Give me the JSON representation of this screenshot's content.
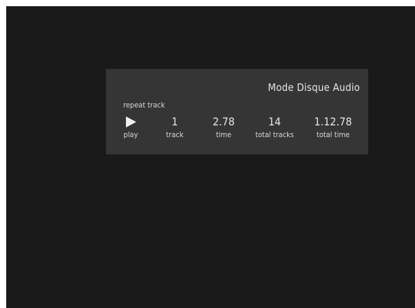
{
  "window": {
    "background": "#1a1a1a",
    "panel_background": "#353535"
  },
  "panel": {
    "mode_title": "Mode Disque Audio",
    "repeat_label": "repeat track",
    "play": {
      "icon": "play-icon",
      "label": "play"
    },
    "track": {
      "value": "1",
      "label": "track"
    },
    "time": {
      "value": "2.78",
      "label": "time"
    },
    "total_tracks": {
      "value": "14",
      "label": "total tracks"
    },
    "total_time": {
      "value": "1.12.78",
      "label": "total time"
    }
  }
}
